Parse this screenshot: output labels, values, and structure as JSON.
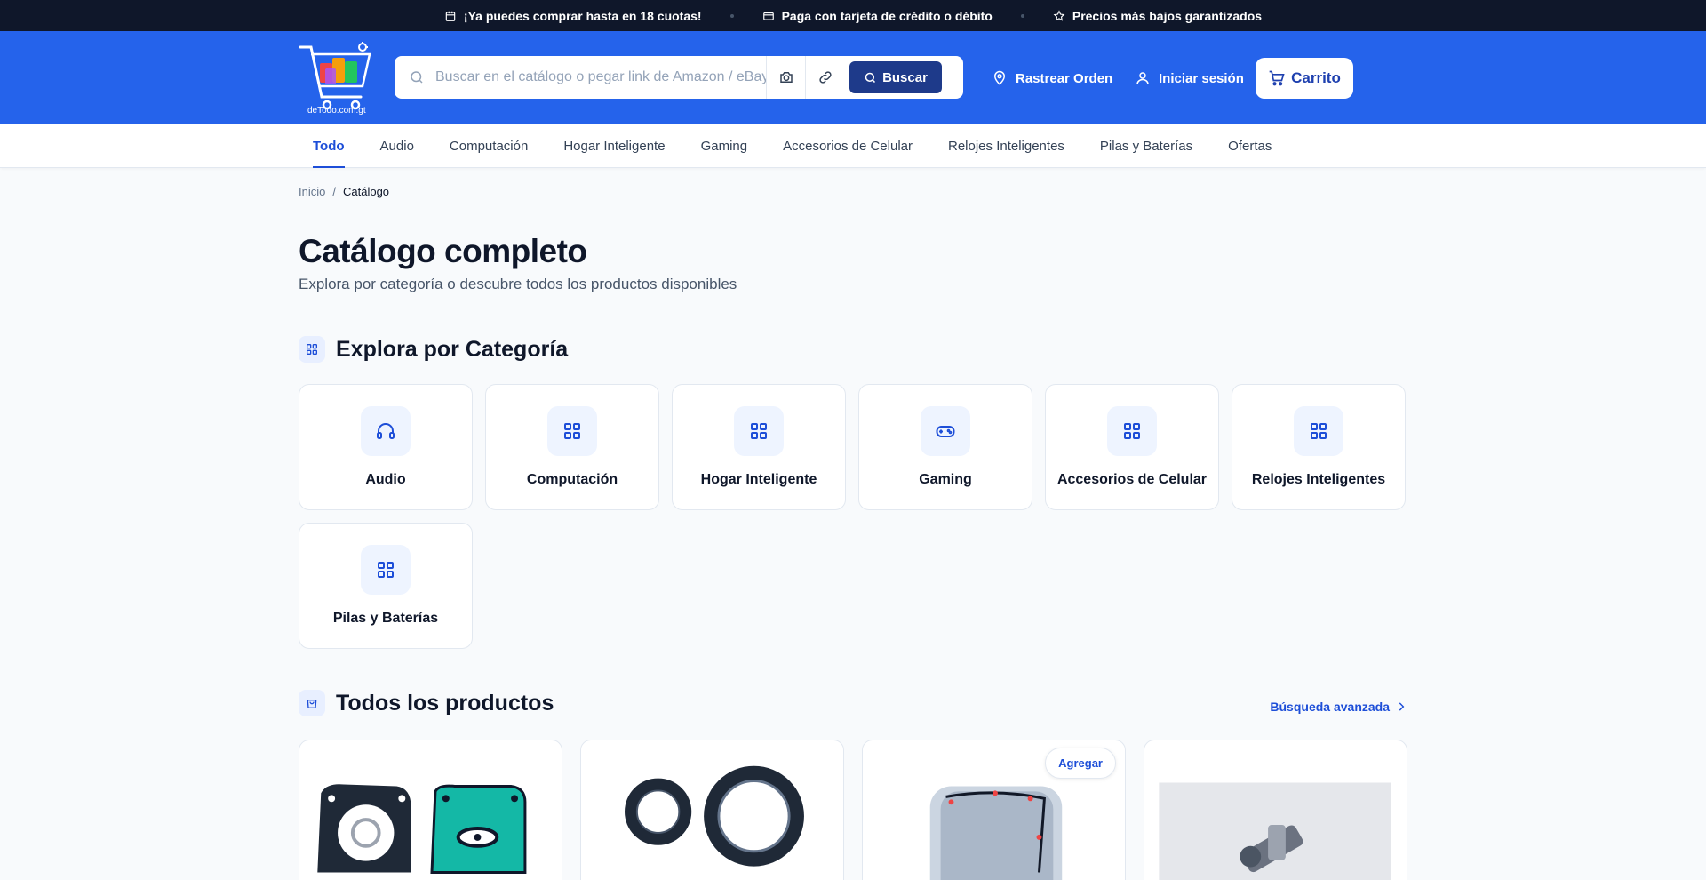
{
  "promo": {
    "items": [
      {
        "icon": "calendar-icon",
        "text": "¡Ya puedes comprar hasta en 18 cuotas!"
      },
      {
        "icon": "credit-card-icon",
        "text": "Paga con tarjeta de crédito o débito"
      },
      {
        "icon": "star-icon",
        "text": "Precios más bajos garantizados"
      }
    ]
  },
  "header": {
    "logo_text": "deTodo.com.gt",
    "search_placeholder": "Buscar en el catálogo o pegar link de Amazon / eBay",
    "search_button": "Buscar",
    "track_order": "Rastrear Orden",
    "login": "Iniciar sesión",
    "cart": "Carrito",
    "brand_color": "#2563eb"
  },
  "nav": {
    "items": [
      "Todo",
      "Audio",
      "Computación",
      "Hogar Inteligente",
      "Gaming",
      "Accesorios de Celular",
      "Relojes Inteligentes",
      "Pilas y Baterías",
      "Ofertas"
    ],
    "active": "Todo"
  },
  "breadcrumb": {
    "home": "Inicio",
    "separator": "/",
    "current": "Catálogo"
  },
  "page": {
    "title": "Catálogo completo",
    "subtitle": "Explora por categoría o descubre todos los productos disponibles"
  },
  "categories": {
    "title": "Explora por Categoría",
    "items": [
      {
        "label": "Audio",
        "icon": "headphones-icon"
      },
      {
        "label": "Computación",
        "icon": "grid-icon"
      },
      {
        "label": "Hogar Inteligente",
        "icon": "grid-icon"
      },
      {
        "label": "Gaming",
        "icon": "gamepad-icon"
      },
      {
        "label": "Accesorios de Celular",
        "icon": "grid-icon"
      },
      {
        "label": "Relojes Inteligentes",
        "icon": "grid-icon"
      },
      {
        "label": "Pilas y Baterías",
        "icon": "grid-icon"
      }
    ]
  },
  "products": {
    "title": "Todos los productos",
    "advanced_search": "Búsqueda avanzada",
    "add_label": "Agregar",
    "items": [
      {
        "image": "gasket-set-image"
      },
      {
        "image": "oil-seals-image"
      },
      {
        "image": "valve-cover-gasket-image"
      },
      {
        "image": "cam-chain-tensioner-image"
      }
    ]
  }
}
